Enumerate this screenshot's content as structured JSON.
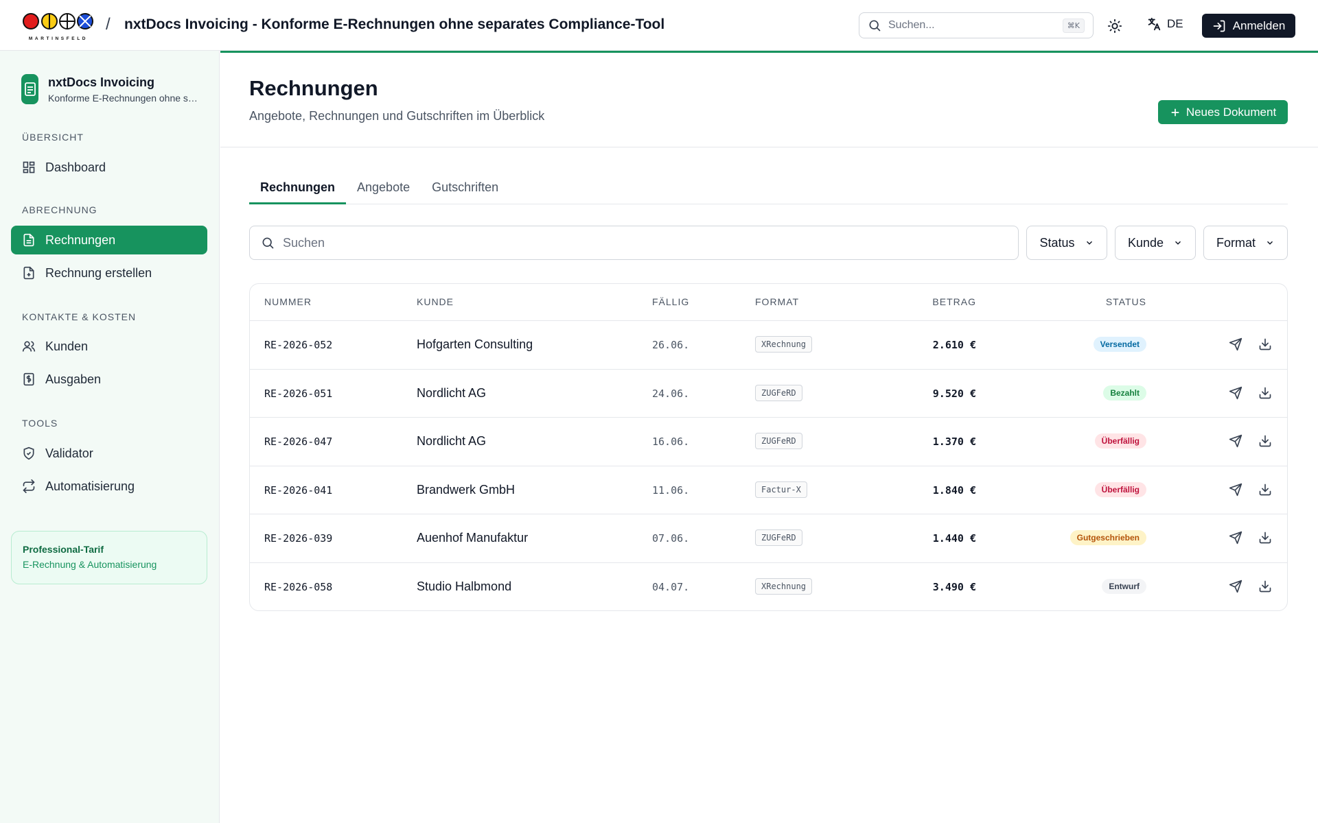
{
  "topbar": {
    "logo_text": "MARTINSFELD",
    "separator": "/",
    "title": "nxtDocs Invoicing - Konforme E-Rechnungen ohne separates Compliance-Tool",
    "search_placeholder": "Suchen...",
    "search_shortcut": "⌘K",
    "theme_icon": "sun-icon",
    "language": "DE",
    "login_label": "Anmelden"
  },
  "sidebar": {
    "product_name": "nxtDocs Invoicing",
    "product_sub": "Konforme E-Rechnungen ohne separates Compliance-Tool",
    "sections": [
      {
        "label": "ÜBERSICHT",
        "items": [
          {
            "label": "Dashboard",
            "icon": "dashboard-icon"
          }
        ]
      },
      {
        "label": "ABRECHNUNG",
        "items": [
          {
            "label": "Rechnungen",
            "icon": "file-text-icon",
            "active": true
          },
          {
            "label": "Rechnung erstellen",
            "icon": "file-plus-icon"
          }
        ]
      },
      {
        "label": "KONTAKTE & KOSTEN",
        "items": [
          {
            "label": "Kunden",
            "icon": "users-icon"
          },
          {
            "label": "Ausgaben",
            "icon": "receipt-icon"
          }
        ]
      },
      {
        "label": "TOOLS",
        "items": [
          {
            "label": "Validator",
            "icon": "shield-check-icon"
          },
          {
            "label": "Automatisierung",
            "icon": "repeat-icon"
          }
        ]
      }
    ],
    "plan": {
      "title": "Professional-Tarif",
      "subtitle": "E-Rechnung & Automatisierung"
    }
  },
  "main": {
    "title": "Rechnungen",
    "subtitle": "Angebote, Rechnungen und Gutschriften im Überblick",
    "new_button": "Neues Dokument",
    "tabs": [
      {
        "label": "Rechnungen",
        "active": true
      },
      {
        "label": "Angebote"
      },
      {
        "label": "Gutschriften"
      }
    ],
    "search_placeholder": "Suchen",
    "filters": [
      "Status",
      "Kunde",
      "Format"
    ],
    "table": {
      "headers": {
        "nummer": "NUMMER",
        "kunde": "KUNDE",
        "faellig": "FÄLLIG",
        "format": "FORMAT",
        "betrag": "BETRAG",
        "status": "STATUS"
      },
      "rows": [
        {
          "nummer": "RE-2026-052",
          "kunde": "Hofgarten Consulting",
          "faellig": "26.06.",
          "format": "XRechnung",
          "betrag": "2.610 €",
          "status": "Versendet"
        },
        {
          "nummer": "RE-2026-051",
          "kunde": "Nordlicht AG",
          "faellig": "24.06.",
          "format": "ZUGFeRD",
          "betrag": "9.520 €",
          "status": "Bezahlt"
        },
        {
          "nummer": "RE-2026-047",
          "kunde": "Nordlicht AG",
          "faellig": "16.06.",
          "format": "ZUGFeRD",
          "betrag": "1.370 €",
          "status": "Überfällig"
        },
        {
          "nummer": "RE-2026-041",
          "kunde": "Brandwerk GmbH",
          "faellig": "11.06.",
          "format": "Factur-X",
          "betrag": "1.840 €",
          "status": "Überfällig"
        },
        {
          "nummer": "RE-2026-039",
          "kunde": "Auenhof Manufaktur",
          "faellig": "07.06.",
          "format": "ZUGFeRD",
          "betrag": "1.440 €",
          "status": "Gutgeschrieben"
        },
        {
          "nummer": "RE-2026-058",
          "kunde": "Studio Halbmond",
          "faellig": "04.07.",
          "format": "XRechnung",
          "betrag": "3.490 €",
          "status": "Entwurf"
        }
      ]
    }
  },
  "status_colors": {
    "Versendet": {
      "bg": "#e0f2fe",
      "fg": "#0369a1"
    },
    "Bezahlt": {
      "bg": "#dcfce7",
      "fg": "#15803d"
    },
    "Überfällig": {
      "bg": "#ffe4e6",
      "fg": "#be123c"
    },
    "Gutgeschrieben": {
      "bg": "#fef3c7",
      "fg": "#b45309"
    },
    "Entwurf": {
      "bg": "#f3f4f6",
      "fg": "#374151"
    }
  },
  "colors": {
    "accent": "#17935e",
    "dark": "#111827"
  }
}
